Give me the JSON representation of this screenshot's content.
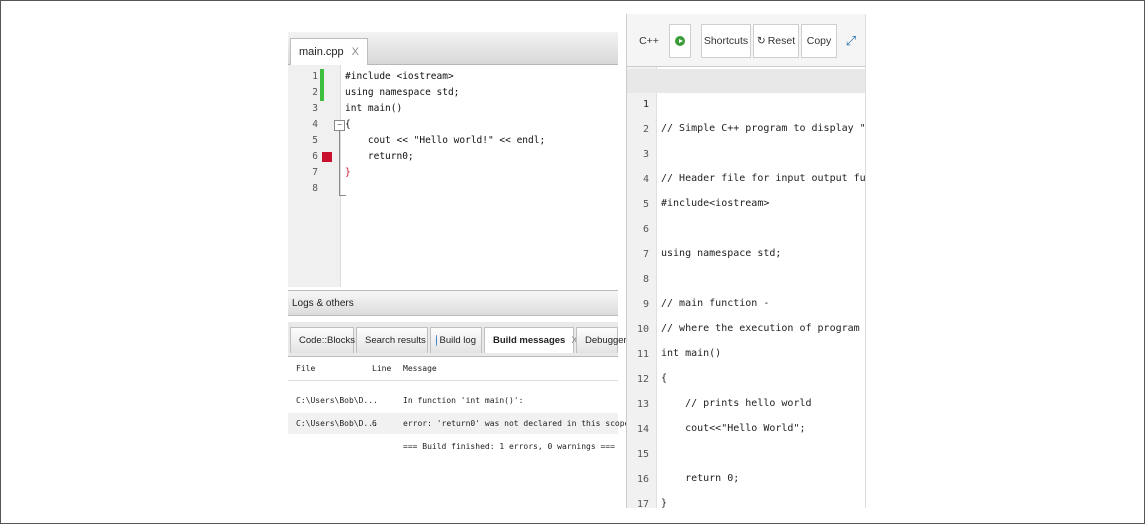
{
  "codeblocks": {
    "file_tab": "main.cpp",
    "close_glyph": "X",
    "lines": [
      {
        "n": "1",
        "text": "#include <iostream>"
      },
      {
        "n": "2",
        "text": "using namespace std;"
      },
      {
        "n": "3",
        "text": "int main()"
      },
      {
        "n": "4",
        "text": "{"
      },
      {
        "n": "5",
        "text": "    cout << \"Hello world!\" << endl;"
      },
      {
        "n": "6",
        "text": "    return0;"
      },
      {
        "n": "7",
        "text": "}"
      },
      {
        "n": "8",
        "text": ""
      }
    ],
    "logs_title": "Logs & others",
    "log_tabs": [
      {
        "label": "Code::Blocks",
        "color": "#e0a020"
      },
      {
        "label": "Search results",
        "color": "#4a90d9"
      },
      {
        "label": "Build log",
        "color": "#3b7fc4"
      },
      {
        "label": "Build messages",
        "color": "#d62828"
      },
      {
        "label": "Debugger",
        "color": "#3b7fc4"
      }
    ],
    "messages": {
      "headers": {
        "file": "File",
        "line": "Line",
        "message": "Message"
      },
      "rows": [
        {
          "file": "C:\\Users\\Bob\\D...",
          "line": "",
          "message": "In function 'int main()':"
        },
        {
          "file": "C:\\Users\\Bob\\D...",
          "line": "6",
          "message": "error: 'return0' was not declared in this scope"
        },
        {
          "file": "",
          "line": "",
          "message": "=== Build finished: 1 errors, 0 warnings ==="
        }
      ]
    }
  },
  "online_editor": {
    "toolbar": {
      "language": "C++",
      "shortcuts": "Shortcuts",
      "reset": "Reset",
      "copy": "Copy",
      "expand": "⤢"
    },
    "lines": [
      {
        "n": "1",
        "text": "// Simple C++ program to display \"Hello"
      },
      {
        "n": "2",
        "text": ""
      },
      {
        "n": "3",
        "text": "// Header file for input output functio"
      },
      {
        "n": "4",
        "text": "#include<iostream>"
      },
      {
        "n": "5",
        "text": ""
      },
      {
        "n": "6",
        "text": "using namespace std;"
      },
      {
        "n": "7",
        "text": ""
      },
      {
        "n": "8",
        "text": "// main function -"
      },
      {
        "n": "9",
        "text": "// where the execution of program begin"
      },
      {
        "n": "10",
        "text": "int main()"
      },
      {
        "n": "11",
        "text": "{"
      },
      {
        "n": "12",
        "text": "    // prints hello world"
      },
      {
        "n": "13",
        "text": "    cout<<\"Hello World\";"
      },
      {
        "n": "14",
        "text": ""
      },
      {
        "n": "15",
        "text": "    return 0;"
      },
      {
        "n": "16",
        "text": "}"
      },
      {
        "n": "17",
        "text": ""
      }
    ]
  }
}
